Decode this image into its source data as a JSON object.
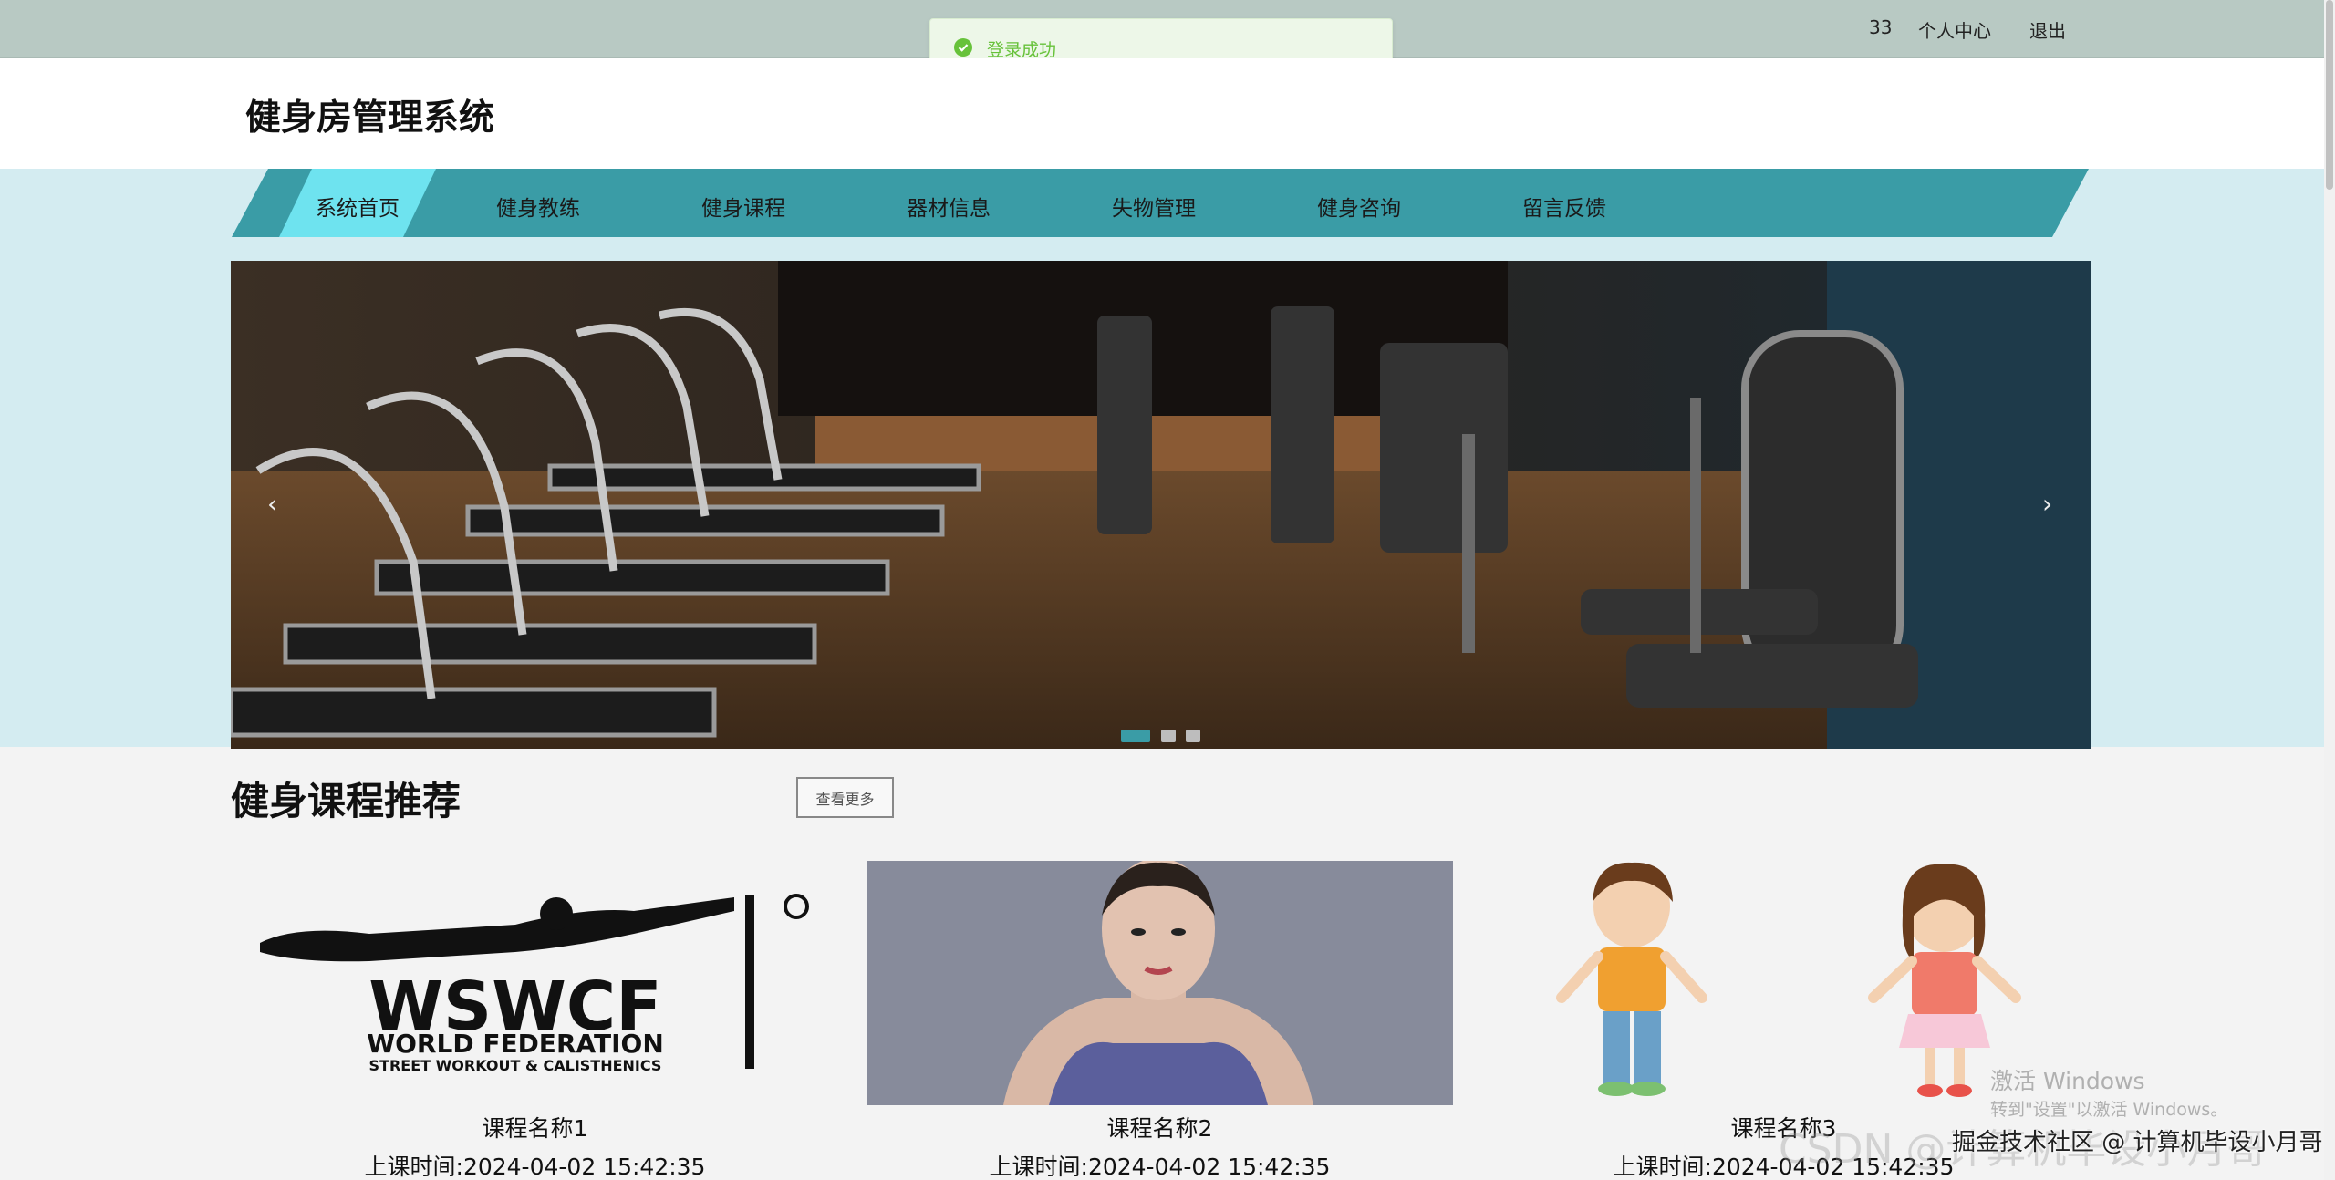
{
  "topbar": {
    "user_id": "33",
    "profile_label": "个人中心",
    "logout_label": "退出"
  },
  "toast": {
    "message": "登录成功"
  },
  "header": {
    "title": "健身房管理系统"
  },
  "nav": {
    "items": [
      {
        "label": "系统首页",
        "active": true
      },
      {
        "label": "健身教练"
      },
      {
        "label": "健身课程"
      },
      {
        "label": "器材信息"
      },
      {
        "label": "失物管理"
      },
      {
        "label": "健身咨询"
      },
      {
        "label": "留言反馈"
      }
    ]
  },
  "banner": {
    "prev_icon": "‹",
    "next_icon": "›",
    "active_slide": 1,
    "slide_count": 3
  },
  "section": {
    "title": "健身课程推荐",
    "more_label": "查看更多"
  },
  "courses": [
    {
      "name": "课程名称1",
      "time": "上课时间:2024-04-02 15:42:35",
      "logo_text": "WSWCF",
      "logo_sub1": "WORLD FEDERATION",
      "logo_sub2": "STREET WORKOUT & CALISTHENICS"
    },
    {
      "name": "课程名称2",
      "time": "上课时间:2024-04-02 15:42:35"
    },
    {
      "name": "课程名称3",
      "time": "上课时间:2024-04-02 15:42:35"
    }
  ],
  "watermarks": {
    "activate_title": "激活 Windows",
    "activate_sub": "转到\"设置\"以激活 Windows。",
    "csdn": "CSDN @计算机毕设小月哥",
    "juejin": "掘金技术社区 @ 计算机毕设小月哥"
  },
  "colors": {
    "topbar": "#b8c9c3",
    "nav_band": "#3a9ca6",
    "nav_active": "#6ee3ef",
    "page_bg": "#f3f3f3",
    "success": "#67c23a"
  }
}
